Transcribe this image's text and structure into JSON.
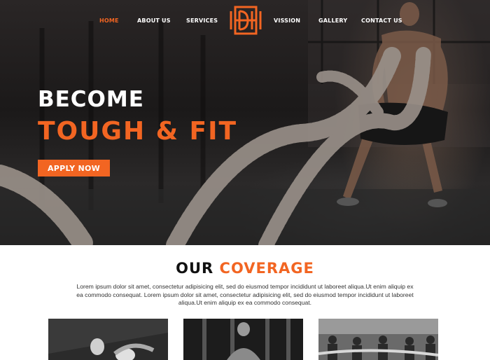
{
  "nav": {
    "items": [
      {
        "label": "HOME",
        "active": true
      },
      {
        "label": "ABOUT US",
        "active": false
      },
      {
        "label": "SERVICES",
        "active": false
      },
      {
        "label": "VISSION",
        "active": false
      },
      {
        "label": "GALLERY",
        "active": false
      },
      {
        "label": "CONTACT US",
        "active": false
      }
    ],
    "logo_icon": "monogram-logo-icon"
  },
  "hero": {
    "title": "BECOME",
    "subtitle": "TOUGH & FIT",
    "button_label": "APPLY NOW"
  },
  "coverage": {
    "title_dark": "OUR",
    "title_orange": "COVERAGE",
    "text": "Lorem ipsum dolor sit amet, consectetur adipisicing elit, sed do eiusmod tempor incididunt ut laboreet aliqua.Ut enim aliquip ex ea commodo consequat. Lorem ipsum dolor sit amet, consectetur adipisicing elit, sed do eiusmod tempor incididunt ut laboreet aliqua.Ut enim aliquip ex ea commodo consequat."
  },
  "colors": {
    "accent": "#f26522",
    "dark": "#111111",
    "white": "#ffffff"
  }
}
